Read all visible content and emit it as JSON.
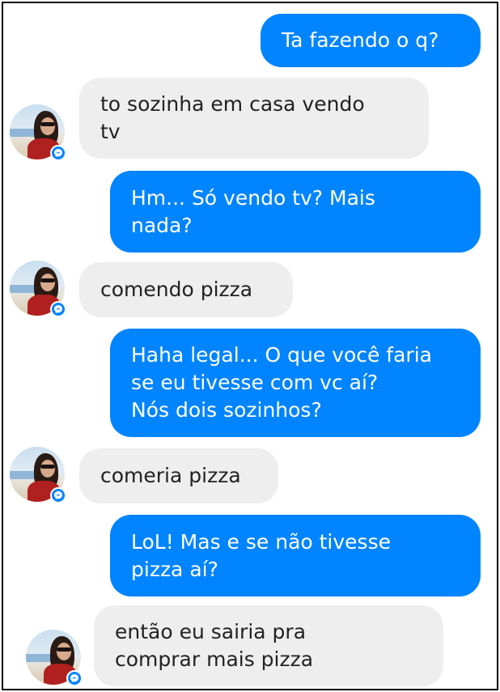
{
  "conversation": {
    "messages": [
      {
        "from": "me",
        "text": "Ta fazendo o q?"
      },
      {
        "from": "them",
        "text": "to sozinha em casa vendo\ntv"
      },
      {
        "from": "me",
        "text": "Hm... Só vendo tv?  Mais\nnada?"
      },
      {
        "from": "them",
        "text": "comendo pizza"
      },
      {
        "from": "me",
        "text": "Haha legal... O que você faria\nse eu tivesse com vc aí?\nNós dois sozinhos?"
      },
      {
        "from": "them",
        "text": "comeria pizza"
      },
      {
        "from": "me",
        "text": "LoL!  Mas e se não tivesse\npizza aí?"
      },
      {
        "from": "them",
        "text": "então eu sairia pra\ncomprar mais pizza"
      }
    ]
  },
  "colors": {
    "outgoing_bubble": "#0084ff",
    "incoming_bubble": "#eeeeee",
    "messenger_badge": "#0084ff"
  },
  "icons": {
    "avatar": "profile-photo",
    "badge": "messenger-icon"
  }
}
